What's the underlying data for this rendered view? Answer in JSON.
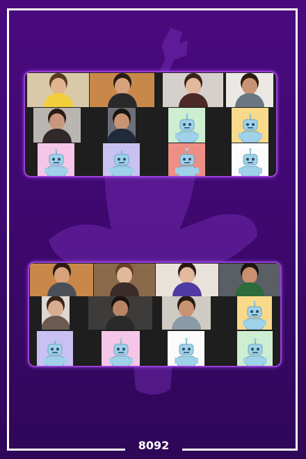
{
  "footer": {
    "number": "8092"
  },
  "colors": {
    "background": "#3f0870",
    "grid_border": "#9b3ddb",
    "tile_bg": "#1e1e1e",
    "robot_body": "#9fd1e8"
  },
  "grids": [
    {
      "name": "top-video-grid",
      "tiles": [
        {
          "type": "photo",
          "bg": "#d9c9a8",
          "skin": "#e0b48f",
          "shirt": "#f2cf3a",
          "hair": "#5a3a22"
        },
        {
          "type": "photo",
          "bg": "#c8884a",
          "skin": "#d8a27c",
          "shirt": "#2a2a2a",
          "hair": "#2a1c12"
        },
        {
          "type": "photo",
          "bg": "#d6d0cc",
          "skin": "#e2b99c",
          "shirt": "#4b2a26",
          "hair": "#3a2418"
        },
        {
          "type": "photo",
          "bg": "#ece9e4",
          "skin": "#c99474",
          "shirt": "#6a7782",
          "hair": "#2a1c12"
        },
        {
          "type": "photo",
          "bg": "#b9b5b0",
          "skin": "#c9987c",
          "shirt": "#30282a",
          "hair": "#2a1c12"
        },
        {
          "type": "photo",
          "bg": "#6a6f78",
          "skin": "#c99474",
          "shirt": "#1f2a3a",
          "hair": "#1a1410"
        },
        {
          "type": "robot",
          "bg": "#cdeed0"
        },
        {
          "type": "robot",
          "bg": "#f9d98a"
        },
        {
          "type": "robot",
          "bg": "#f6c6e8"
        },
        {
          "type": "robot",
          "bg": "#c9c1f2"
        },
        {
          "type": "robot",
          "bg": "#ee8f86"
        },
        {
          "type": "robot",
          "bg": "#fbfbfb"
        }
      ]
    },
    {
      "name": "bottom-video-grid",
      "tiles": [
        {
          "type": "photo",
          "bg": "#c8884a",
          "skin": "#d8a27c",
          "shirt": "#4b4f58",
          "hair": "#2a1c12"
        },
        {
          "type": "photo",
          "bg": "#8a6a4a",
          "skin": "#e0b89a",
          "shirt": "#3a2c28",
          "hair": "#6a4228"
        },
        {
          "type": "photo",
          "bg": "#e9e2da",
          "skin": "#e2b99c",
          "shirt": "#4e3aa0",
          "hair": "#2a1a12"
        },
        {
          "type": "photo",
          "bg": "#5a5f66",
          "skin": "#c89070",
          "shirt": "#2d6b3a",
          "hair": "#1a1410"
        },
        {
          "type": "photo",
          "bg": "#ddd8d2",
          "skin": "#d8ad90",
          "shirt": "#6a5a50",
          "hair": "#3a2418"
        },
        {
          "type": "photo",
          "bg": "#3e3c3a",
          "skin": "#b78466",
          "shirt": "#2a2a2a",
          "hair": "#1a1410"
        },
        {
          "type": "photo",
          "bg": "#cfcac2",
          "skin": "#c99474",
          "shirt": "#8a9aa6",
          "hair": "#2a1c12"
        },
        {
          "type": "robot",
          "bg": "#f9d98a"
        },
        {
          "type": "robot",
          "bg": "#c9c1f2"
        },
        {
          "type": "robot",
          "bg": "#f6c6e8"
        },
        {
          "type": "robot",
          "bg": "#fbfbfb"
        },
        {
          "type": "robot",
          "bg": "#cdeed0"
        }
      ]
    }
  ]
}
